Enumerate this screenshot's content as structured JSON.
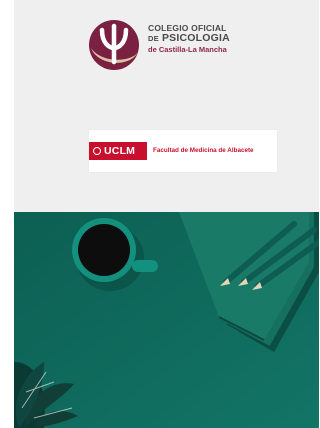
{
  "header": {
    "line1": "COLEGIO OFICIAL",
    "line2_prefix": "DE",
    "line2_main": "PSICOLOGIA",
    "line3": "de Castilla-La Mancha"
  },
  "uclm": {
    "brand": "UCLM",
    "faculty": "Facultad de Medicina de Albacete"
  },
  "colors": {
    "background": "#efefef",
    "accent_red": "#c8102e",
    "accent_purple": "#8e2a4a",
    "photo_green": "#0e6b5d"
  }
}
